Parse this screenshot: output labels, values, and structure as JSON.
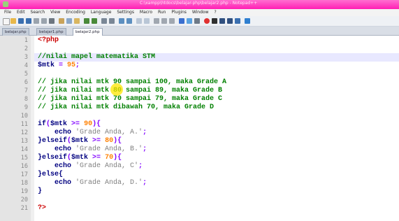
{
  "window": {
    "title": "C:\\xampp\\htdocs\\belajar-php\\belajar2.php - Notepad++"
  },
  "menu": [
    "File",
    "Edit",
    "Search",
    "View",
    "Encoding",
    "Language",
    "Settings",
    "Macro",
    "Run",
    "Plugins",
    "Window",
    "?"
  ],
  "tabs": [
    {
      "label": "belajar.php"
    },
    {
      "label": "belajar1.php"
    },
    {
      "label": "belajar2.php"
    }
  ],
  "editor": {
    "line_numbers": [
      "1",
      "2",
      "3",
      "4",
      "5",
      "6",
      "7",
      "8",
      "9",
      "10",
      "11",
      "12",
      "13",
      "14",
      "15",
      "16",
      "17",
      "18",
      "19",
      "20",
      "21"
    ],
    "current_line": 3,
    "lines": {
      "l1": {
        "tag": "<?php"
      },
      "l3": "//nilai mapel matematika STM",
      "l4": {
        "var": "$mtk",
        "op": " = ",
        "num": "95",
        "end": ";"
      },
      "l6": "// jika nilai mtk 90 sampai 100, maka Grade A",
      "l7": "// jika nilai mtk 80 sampai 89, maka Grade B",
      "l8": "// jika nilai mtk 70 sampai 79, maka Grade C",
      "l9": "// jika nilai mtk dibawah 70, maka Grade D",
      "l11": {
        "kw": "if",
        "open": "(",
        "var": "$mtk",
        "op": " >= ",
        "num": "90",
        "close": "){"
      },
      "l12": {
        "kw": "echo",
        "str": "'Grade Anda, A.'",
        "end": ";"
      },
      "l13": {
        "kw": "}elseif",
        "open": "(",
        "var": "$mtk",
        "op": " >= ",
        "num": "80",
        "close": "){"
      },
      "l14": {
        "kw": "echo",
        "str": "'Grade Anda, B.'",
        "end": ";"
      },
      "l15": {
        "kw": "}elseif",
        "open": "(",
        "var": "$mtk",
        "op": " >= ",
        "num": "70",
        "close": "){"
      },
      "l16": {
        "kw": "echo",
        "str": "'Grade Anda, C'",
        "end": ";"
      },
      "l17": {
        "kw": "}else{"
      },
      "l18": {
        "kw": "echo",
        "str": "'Grade Anda, D.'",
        "end": ";"
      },
      "l19": {
        "kw": "}"
      },
      "l21": {
        "tag": "?>"
      }
    }
  }
}
